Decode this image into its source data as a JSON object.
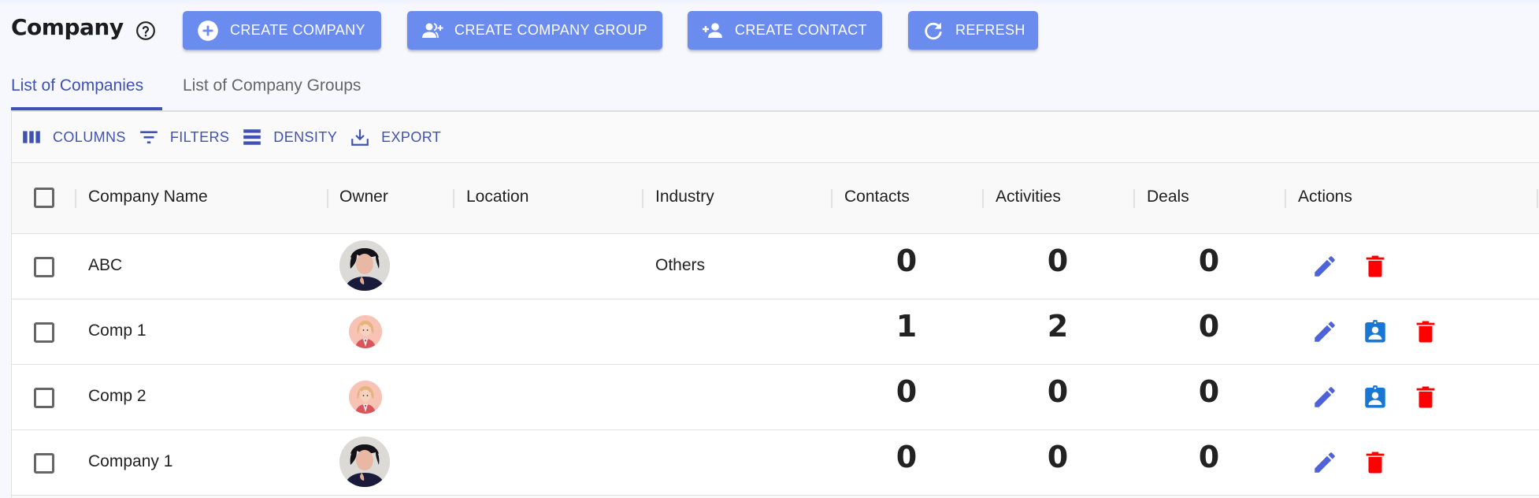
{
  "header": {
    "title": "Company",
    "help_icon": "help-circle-icon"
  },
  "toolbar_buttons": [
    {
      "label": "CREATE COMPANY",
      "icon": "add-circle-icon"
    },
    {
      "label": "CREATE COMPANY GROUP",
      "icon": "group-add-icon"
    },
    {
      "label": "CREATE CONTACT",
      "icon": "person-add-icon"
    },
    {
      "label": "REFRESH",
      "icon": "refresh-icon"
    }
  ],
  "tabs": [
    {
      "label": "List of Companies",
      "active": true
    },
    {
      "label": "List of Company Groups",
      "active": false
    }
  ],
  "grid_toolbar": [
    {
      "label": "COLUMNS",
      "icon": "columns-icon"
    },
    {
      "label": "FILTERS",
      "icon": "filter-icon"
    },
    {
      "label": "DENSITY",
      "icon": "density-icon"
    },
    {
      "label": "EXPORT",
      "icon": "export-icon"
    }
  ],
  "columns": [
    "Company Name",
    "Owner",
    "Location",
    "Industry",
    "Contacts",
    "Activities",
    "Deals",
    "Actions"
  ],
  "rows": [
    {
      "name": "ABC",
      "owner_avatar": "photo",
      "location": "",
      "industry": "Others",
      "contacts": "0",
      "activities": "0",
      "deals": "0",
      "actions": [
        "edit",
        "delete"
      ]
    },
    {
      "name": "Comp 1",
      "owner_avatar": "cartoon",
      "location": "",
      "industry": "",
      "contacts": "1",
      "activities": "2",
      "deals": "0",
      "actions": [
        "edit",
        "contact",
        "delete"
      ]
    },
    {
      "name": "Comp 2",
      "owner_avatar": "cartoon",
      "location": "",
      "industry": "",
      "contacts": "0",
      "activities": "0",
      "deals": "0",
      "actions": [
        "edit",
        "contact",
        "delete"
      ]
    },
    {
      "name": "Company 1",
      "owner_avatar": "photo",
      "location": "",
      "industry": "",
      "contacts": "0",
      "activities": "0",
      "deals": "0",
      "actions": [
        "edit",
        "delete"
      ]
    }
  ],
  "colors": {
    "primary": "#3f51b5",
    "button_bg": "#6b8cef",
    "edit_icon": "#4f63d8",
    "contact_icon": "#1976d2",
    "delete_icon": "#ff0000"
  }
}
